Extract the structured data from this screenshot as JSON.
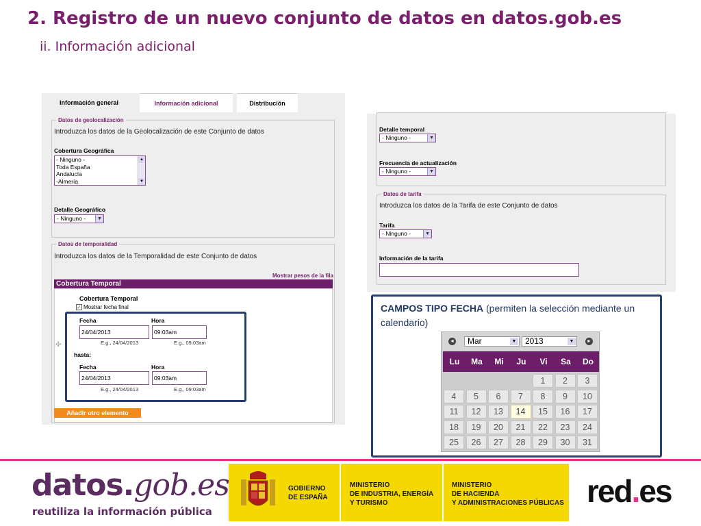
{
  "slide": {
    "title": "2. Registro de un nuevo conjunto de datos en datos.gob.es",
    "subtitle": "ii. Información adicional"
  },
  "tabs": [
    "Información general",
    "Información adicional",
    "Distribución"
  ],
  "geo": {
    "legend": "Datos de geolocalización",
    "hint": "Introduzca los datos de la Geolocalización de este Conjunto de datos",
    "coverage_label": "Cobertura Geográfica",
    "coverage_options": [
      "- Ninguno -",
      "Toda España",
      "Andalucía",
      "-Almería"
    ],
    "detail_label": "Detalle Geográfico",
    "detail_value": "- Ninguno -"
  },
  "temporal": {
    "legend": "Datos de temporalidad",
    "hint": "Introduzca los datos de la Temporalidad de este Conjunto de datos",
    "show_weights_link": "Mostrar pesos de la fila",
    "bar_label": "Cobertura Temporal",
    "inner_title": "Cobertura Temporal",
    "show_end_date": "Mostrar fecha final",
    "date_label": "Fecha",
    "time_label": "Hora",
    "until_label": "hasta:",
    "start_date": "24/04/2013",
    "start_time": "09:03am",
    "end_date": "24/04/2013",
    "end_time": "09:03am",
    "date_example": "E.g., 24/04/2013",
    "time_example": "E.g., 09:03am",
    "add_button": "Añadir otro elemento"
  },
  "right_form": {
    "temporal_detail_label": "Detalle temporal",
    "temporal_detail_value": "- Ninguno -",
    "update_freq_label": "Frecuencia de actualización",
    "update_freq_value": "- Ninguno -",
    "tariff_legend": "Datos de tarifa",
    "tariff_hint": "Introduzca los datos de la Tarifa de este Conjunto de datos",
    "tariff_label": "Tarifa",
    "tariff_value": "- Ninguno -",
    "tariff_info_label": "Información de la tarifa",
    "tariff_info_value": ""
  },
  "callout": {
    "bold": "CAMPOS TIPO FECHA",
    "rest": " (permiten la selección mediante un calendario)"
  },
  "calendar": {
    "month": "Mar",
    "year": "2013",
    "prev_icon": "◄",
    "next_icon": "►",
    "weekdays": [
      "Lu",
      "Ma",
      "Mi",
      "Ju",
      "Vi",
      "Sa",
      "Do"
    ],
    "weeks": [
      [
        "",
        "",
        "",
        "",
        "1",
        "2",
        "3"
      ],
      [
        "4",
        "5",
        "6",
        "7",
        "8",
        "9",
        "10"
      ],
      [
        "11",
        "12",
        "13",
        "14",
        "15",
        "16",
        "17"
      ],
      [
        "18",
        "19",
        "20",
        "21",
        "22",
        "23",
        "24"
      ],
      [
        "25",
        "26",
        "27",
        "28",
        "29",
        "30",
        "31"
      ]
    ],
    "highlighted_day": "14"
  },
  "footer": {
    "datos_logo_1": "datos.",
    "datos_logo_2": "gob",
    "datos_logo_3": ".es",
    "tagline": "reutiliza la información pública",
    "gov1": "GOBIERNO\nDE ESPAÑA",
    "gov2": "MINISTERIO\nDE INDUSTRIA, ENERGÍA\nY TURISMO",
    "gov3": "MINISTERIO\nDE HACIENDA\nY ADMINISTRACIONES PÚBLICAS",
    "red_1": "red",
    "red_2": ".",
    "red_3": "es",
    "colors": {
      "purple": "#7a1f6b",
      "pink": "#e2358a",
      "yellow": "#f5d800",
      "navy": "#263f73"
    }
  }
}
